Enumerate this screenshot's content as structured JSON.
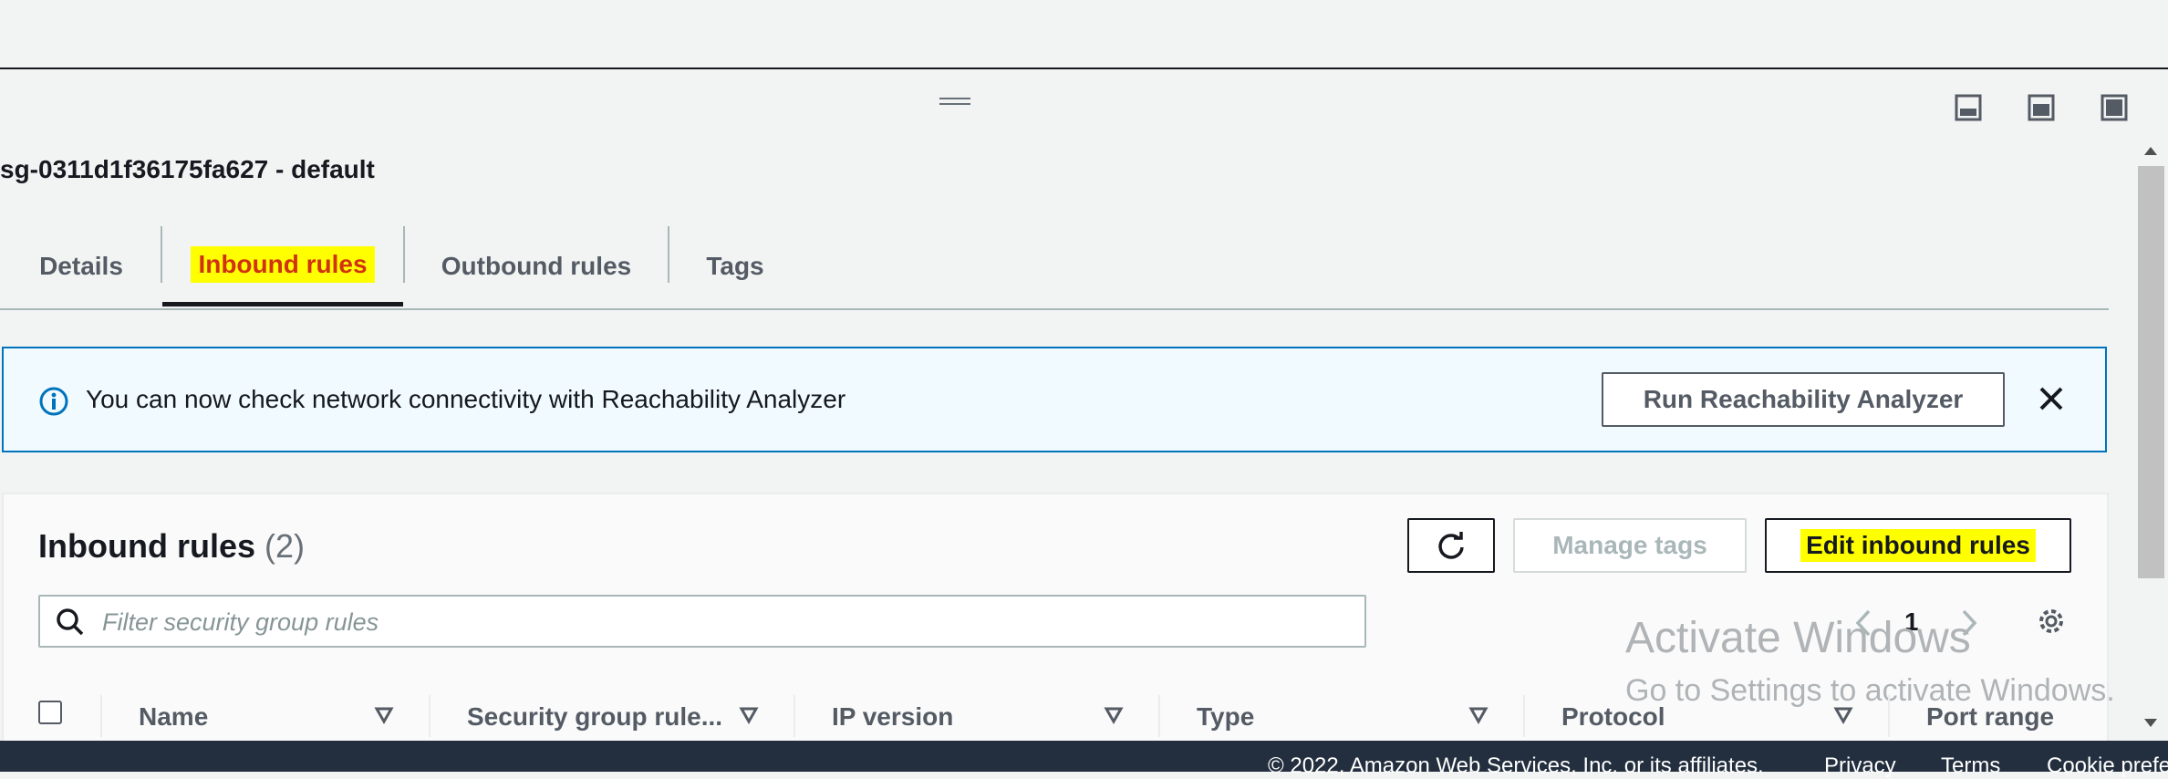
{
  "panel_header": {
    "title": "sg-0311d1f36175fa627 - default"
  },
  "tabs": [
    {
      "label": "Details"
    },
    {
      "label": "Inbound rules"
    },
    {
      "label": "Outbound rules"
    },
    {
      "label": "Tags"
    }
  ],
  "banner": {
    "message": "You can now check network connectivity with Reachability Analyzer",
    "button_label": "Run Reachability Analyzer"
  },
  "rules": {
    "title": "Inbound rules",
    "count": "(2)",
    "manage_tags_label": "Manage tags",
    "edit_label": "Edit inbound rules",
    "filter_placeholder": "Filter security group rules",
    "page_number": "1",
    "columns": [
      "Name",
      "Security group rule...",
      "IP version",
      "Type",
      "Protocol",
      "Port range"
    ]
  },
  "watermark": {
    "line1": "Activate Windows",
    "line2": "Go to Settings to activate Windows."
  },
  "footer": {
    "copyright": "© 2022, Amazon Web Services, Inc. or its affiliates.",
    "privacy": "Privacy",
    "terms": "Terms",
    "cookie": "Cookie prefe"
  },
  "colors": {
    "accent_blue": "#0073bb",
    "highlight": "#ffff00",
    "active_tab_text": "#d13212",
    "footer_bg": "#232f3e"
  }
}
